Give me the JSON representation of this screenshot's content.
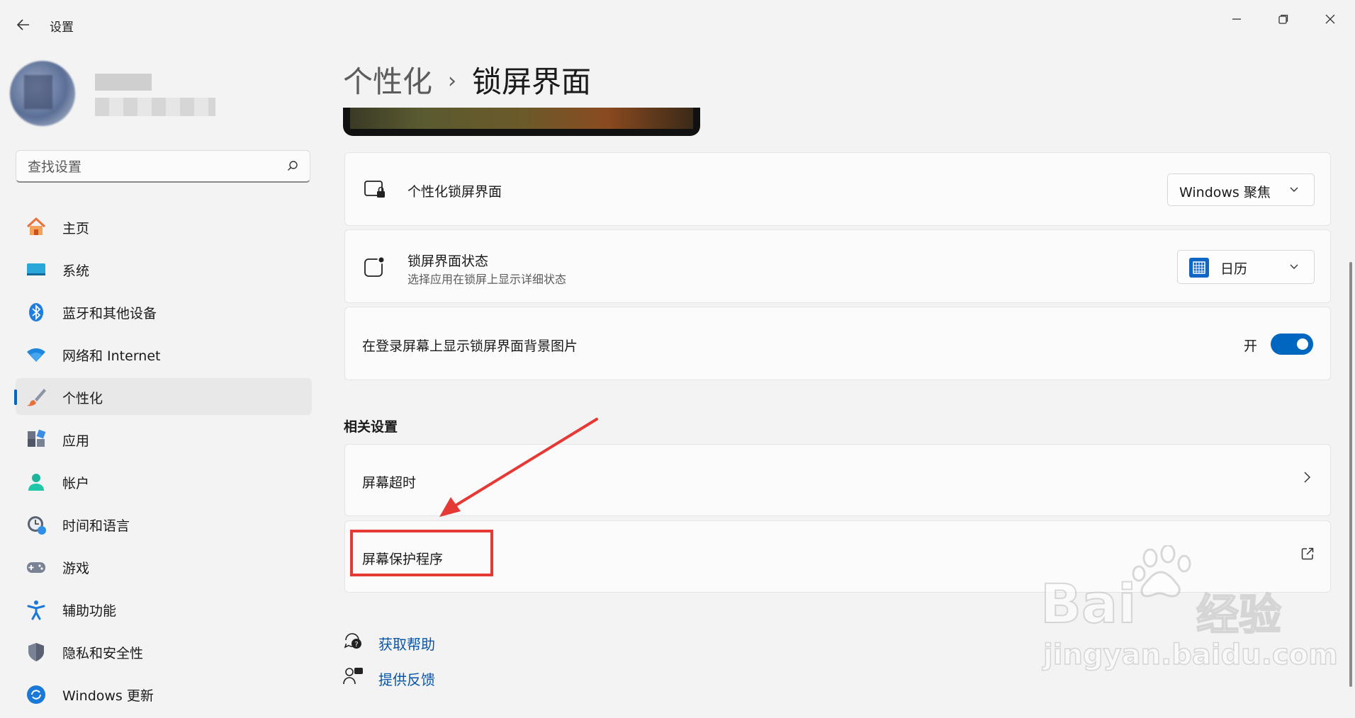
{
  "window": {
    "title": "设置",
    "back_icon": "back-arrow-icon"
  },
  "search": {
    "placeholder": "查找设置"
  },
  "sidebar": {
    "items": [
      {
        "label": "主页",
        "icon": "home-icon"
      },
      {
        "label": "系统",
        "icon": "system-icon"
      },
      {
        "label": "蓝牙和其他设备",
        "icon": "bluetooth-icon"
      },
      {
        "label": "网络和 Internet",
        "icon": "wifi-icon"
      },
      {
        "label": "个性化",
        "icon": "brush-icon",
        "active": true
      },
      {
        "label": "应用",
        "icon": "apps-icon"
      },
      {
        "label": "帐户",
        "icon": "account-icon"
      },
      {
        "label": "时间和语言",
        "icon": "time-language-icon"
      },
      {
        "label": "游戏",
        "icon": "gamepad-icon"
      },
      {
        "label": "辅助功能",
        "icon": "accessibility-icon"
      },
      {
        "label": "隐私和安全性",
        "icon": "shield-icon"
      },
      {
        "label": "Windows 更新",
        "icon": "update-icon"
      }
    ]
  },
  "breadcrumb": {
    "parent": "个性化",
    "separator": "›",
    "current": "锁屏界面"
  },
  "settings": {
    "personalize": {
      "title": "个性化锁屏界面",
      "value": "Windows 聚焦"
    },
    "status": {
      "title": "锁屏界面状态",
      "subtitle": "选择应用在锁屏上显示详细状态",
      "value": "日历"
    },
    "signin_bg": {
      "title": "在登录屏幕上显示锁屏界面背景图片",
      "state": "开"
    }
  },
  "related": {
    "title": "相关设置",
    "items": [
      {
        "label": "屏幕超时"
      },
      {
        "label": "屏幕保护程序"
      }
    ]
  },
  "help": {
    "get_help": "获取帮助",
    "feedback": "提供反馈"
  },
  "watermark": {
    "brand": "Bai",
    "brand2": "经验",
    "url": "jingyan.baidu.com"
  },
  "colors": {
    "accent": "#0067c0",
    "highlight": "#e53935"
  }
}
